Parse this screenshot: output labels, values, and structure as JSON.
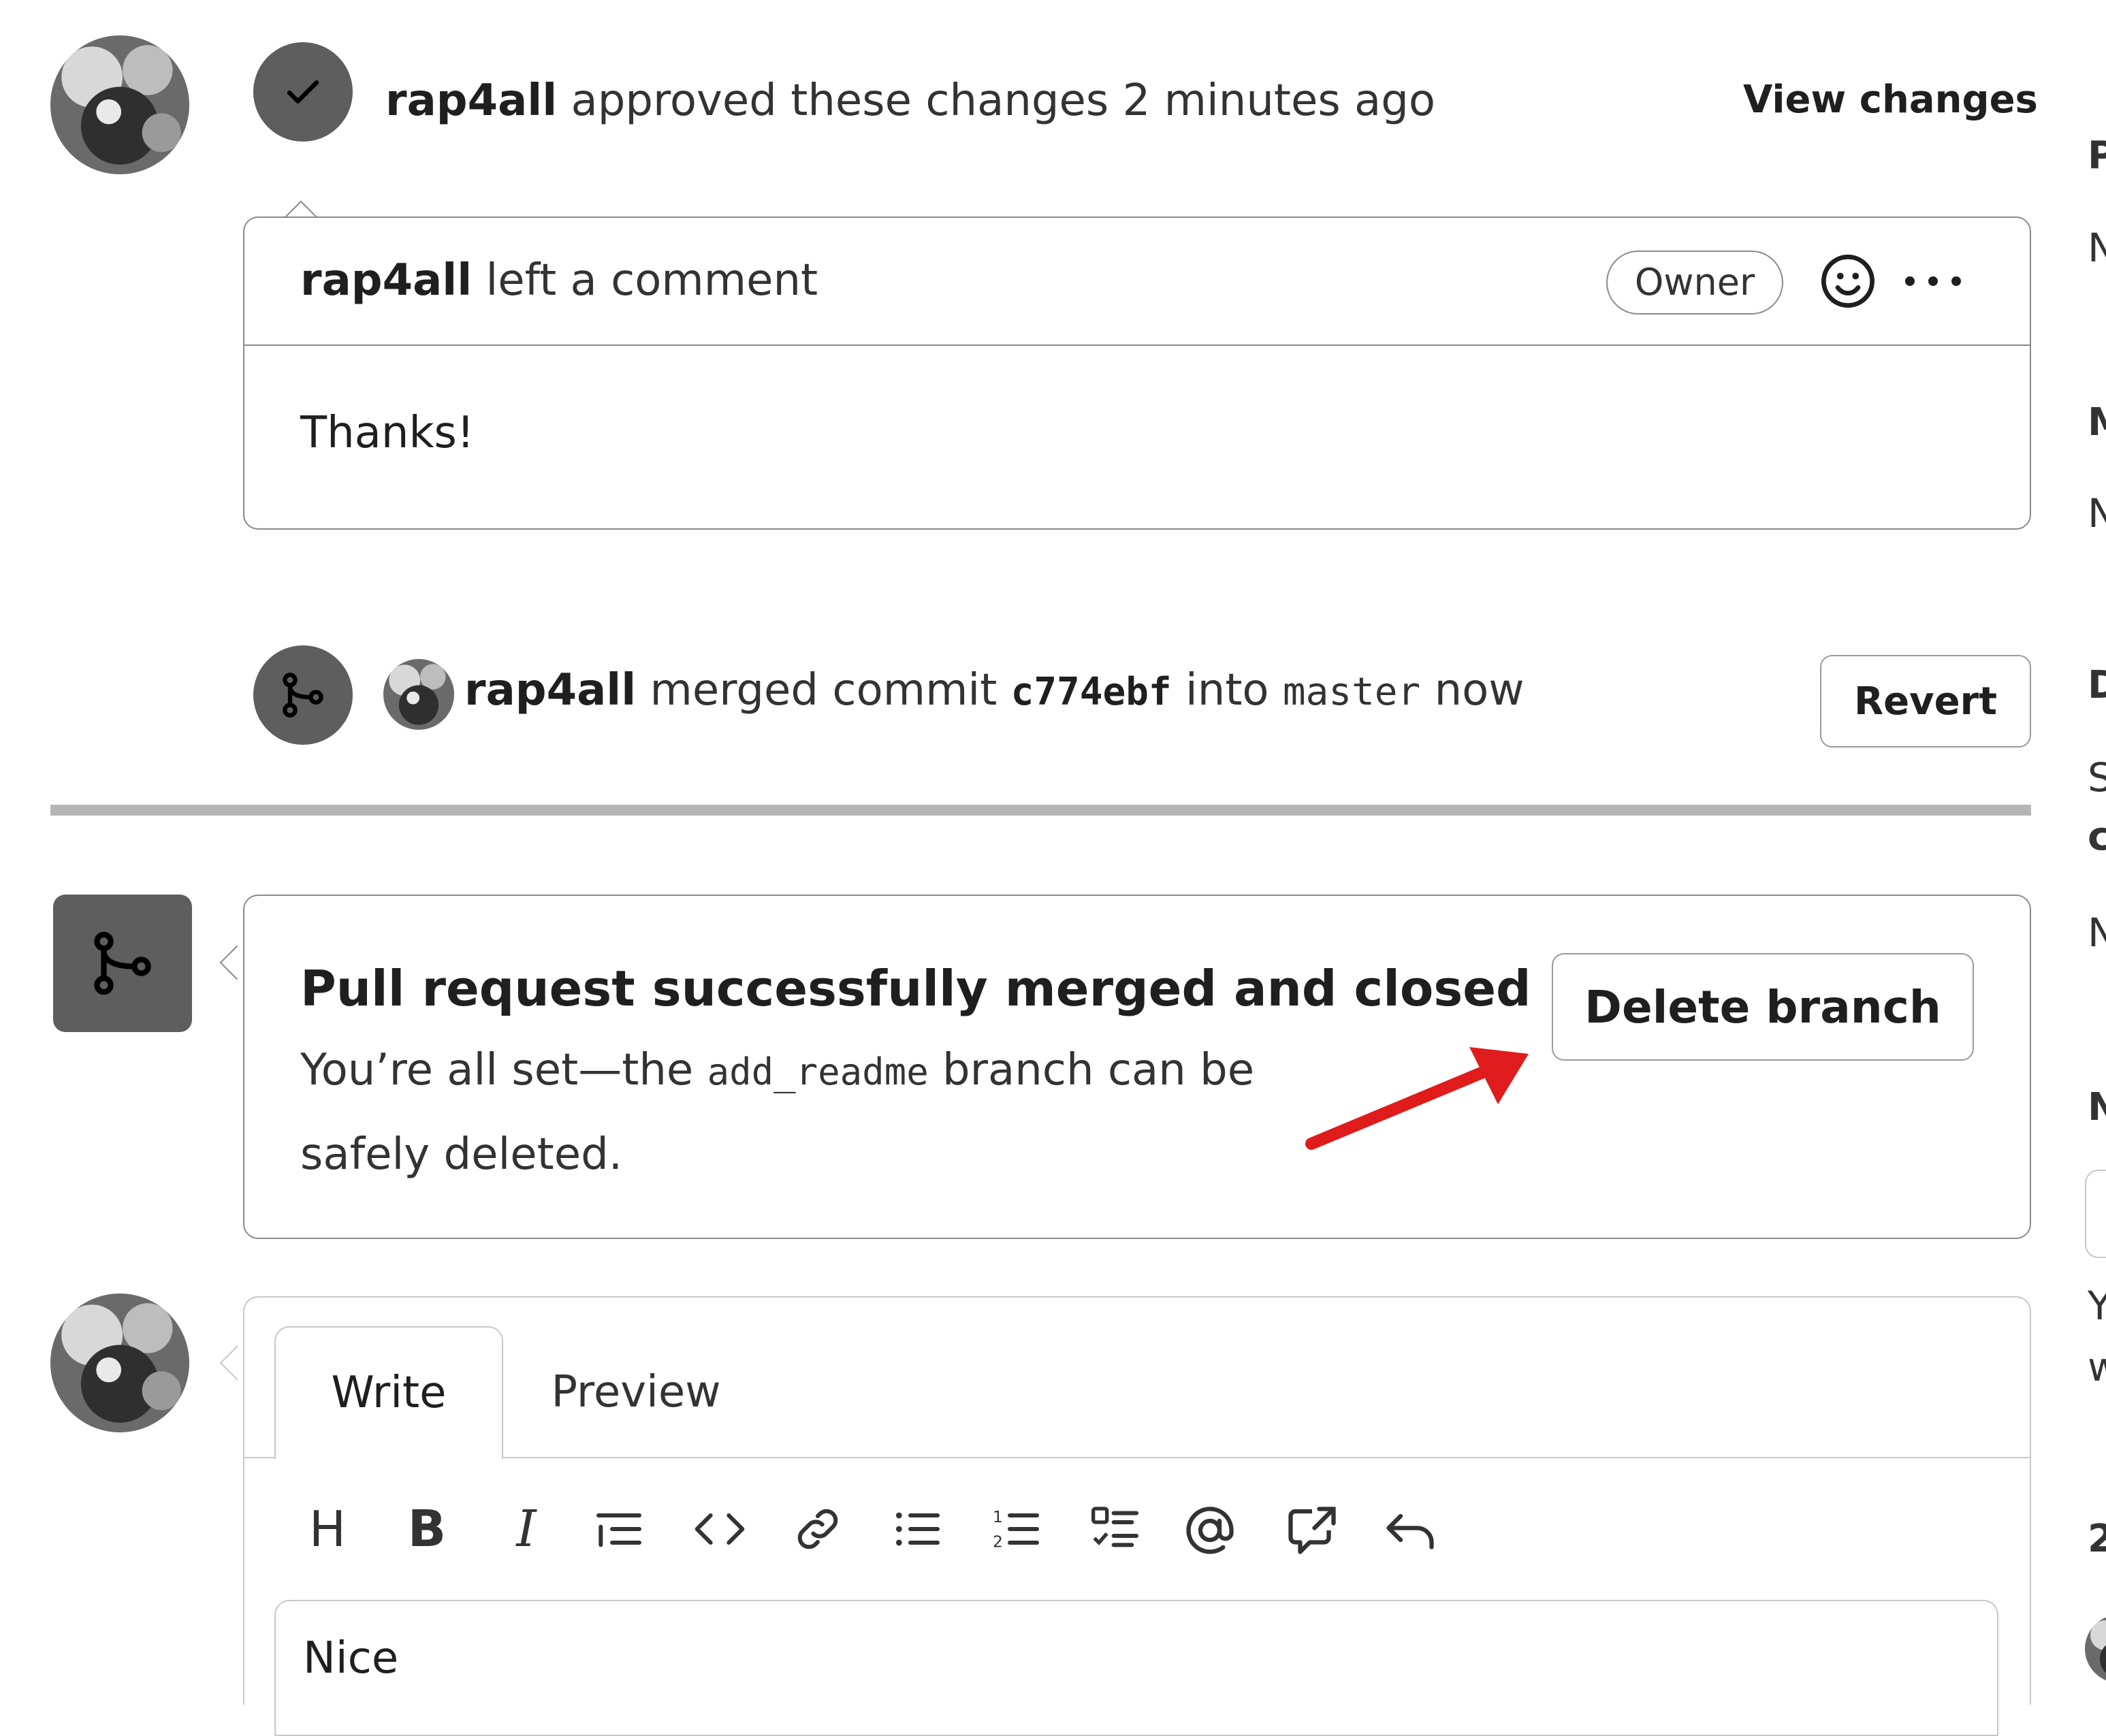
{
  "review": {
    "user": "rap4all",
    "action": "approved these changes 2 minutes ago",
    "view_changes": "View changes"
  },
  "comment": {
    "user": "rap4all",
    "action": "left a comment",
    "badge": "Owner",
    "body": "Thanks!"
  },
  "merge_event": {
    "user": "rap4all",
    "text1": "merged commit",
    "commit": "c774ebf",
    "text2": "into",
    "branch": "master",
    "text3": "now",
    "revert": "Revert"
  },
  "merged_box": {
    "title": "Pull request successfully merged and closed",
    "desc_pre": "You’re all set—the",
    "branch": "add_readme",
    "desc_post": "branch can be",
    "desc_line2": "safely deleted.",
    "delete_button": "Delete branch"
  },
  "editor": {
    "tabs": [
      "Write",
      "Preview"
    ],
    "text": "Nice",
    "toolbar_icons": [
      "heading-icon",
      "bold-icon",
      "italic-icon",
      "quote-icon",
      "code-icon",
      "link-icon",
      "bulleted-list-icon",
      "numbered-list-icon",
      "task-list-icon",
      "mention-icon",
      "cross-reference-icon",
      "undo-icon"
    ],
    "toolbar_labels": {
      "heading": "H",
      "bold": "B",
      "italic": "I"
    }
  },
  "sidebar_fragments": [
    "P",
    "N",
    "M",
    "N",
    "D",
    "S",
    "c",
    "N",
    "N",
    "Y",
    "w",
    "2"
  ],
  "colors": {
    "annotation_arrow": "#e01b1b",
    "badge_bg": "#5e5e5e",
    "divider": "#b5b5b5"
  }
}
